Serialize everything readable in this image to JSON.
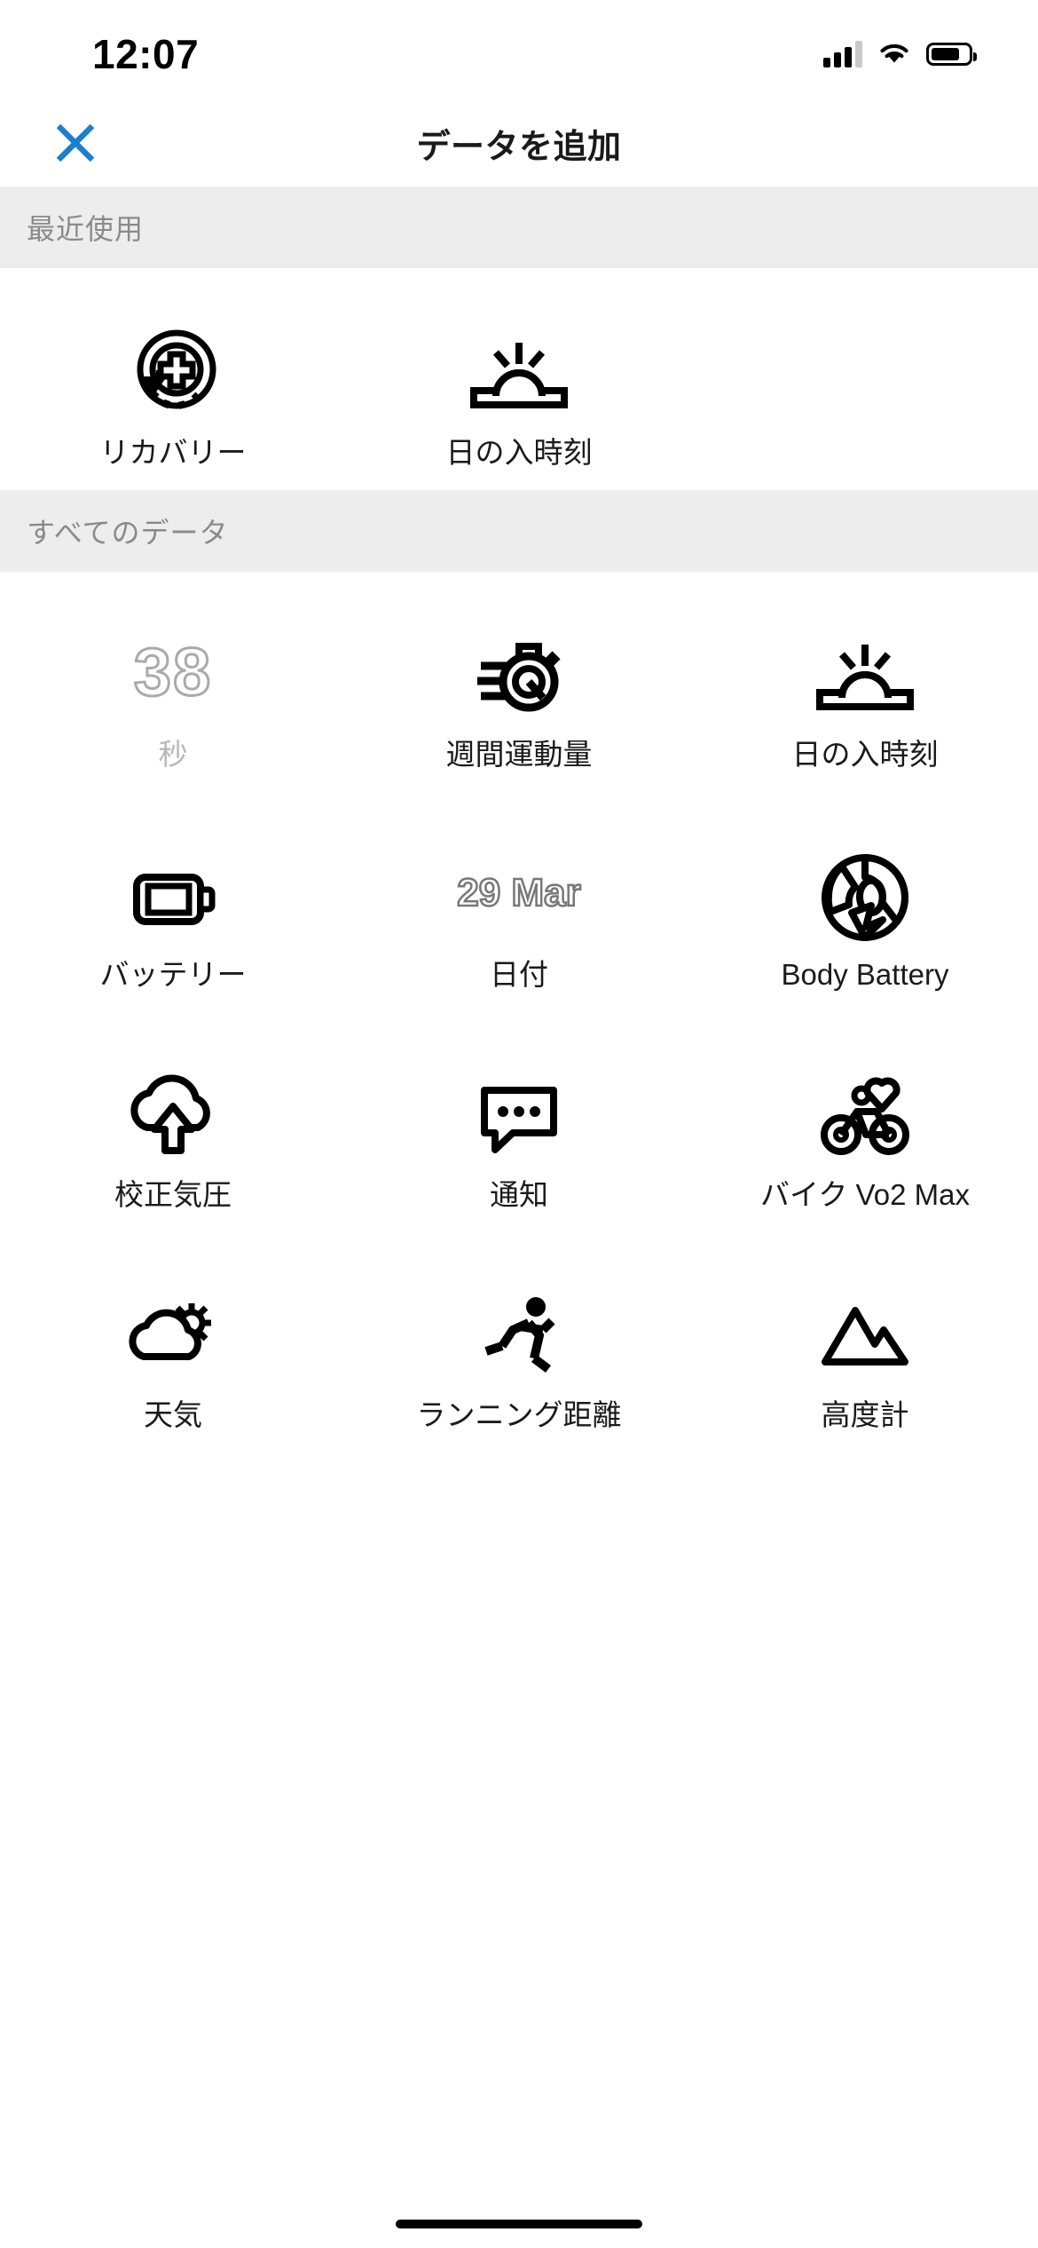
{
  "status_bar": {
    "time": "12:07",
    "cellular_icon": "signal-bars-icon",
    "wifi_icon": "wifi-icon",
    "battery_icon": "battery-icon"
  },
  "header": {
    "close_icon": "close-x-icon",
    "title": "データを追加",
    "close_color": "#1a7fd4"
  },
  "sections": [
    {
      "id": "recent",
      "title": "最近使用",
      "items": [
        {
          "label": "リカバリー",
          "icon": "recovery-icon",
          "disabled": false
        },
        {
          "label": "日の入時刻",
          "icon": "sunset-icon",
          "disabled": false
        }
      ]
    },
    {
      "id": "all-data",
      "title": "すべてのデータ",
      "items": [
        {
          "label": "秒",
          "icon": "seconds-icon",
          "value": "38",
          "disabled": true
        },
        {
          "label": "週間運動量",
          "icon": "weekly-intensity-icon",
          "disabled": false
        },
        {
          "label": "日の入時刻",
          "icon": "sunset-icon",
          "disabled": false
        },
        {
          "label": "バッテリー",
          "icon": "battery-watch-icon",
          "disabled": false
        },
        {
          "label": "日付",
          "icon": "date-icon",
          "value": "29 Mar",
          "disabled": false
        },
        {
          "label": "Body Battery",
          "icon": "body-battery-icon",
          "disabled": false
        },
        {
          "label": "校正気圧",
          "icon": "barometric-pressure-icon",
          "disabled": false
        },
        {
          "label": "通知",
          "icon": "notification-icon",
          "disabled": false
        },
        {
          "label": "バイク Vo2 Max",
          "icon": "bike-vo2max-icon",
          "disabled": false
        },
        {
          "label": "天気",
          "icon": "weather-icon",
          "disabled": false
        },
        {
          "label": "ランニング距離",
          "icon": "running-distance-icon",
          "disabled": false
        },
        {
          "label": "高度計",
          "icon": "altimeter-icon",
          "disabled": false
        }
      ]
    }
  ],
  "home_indicator": "home-indicator"
}
